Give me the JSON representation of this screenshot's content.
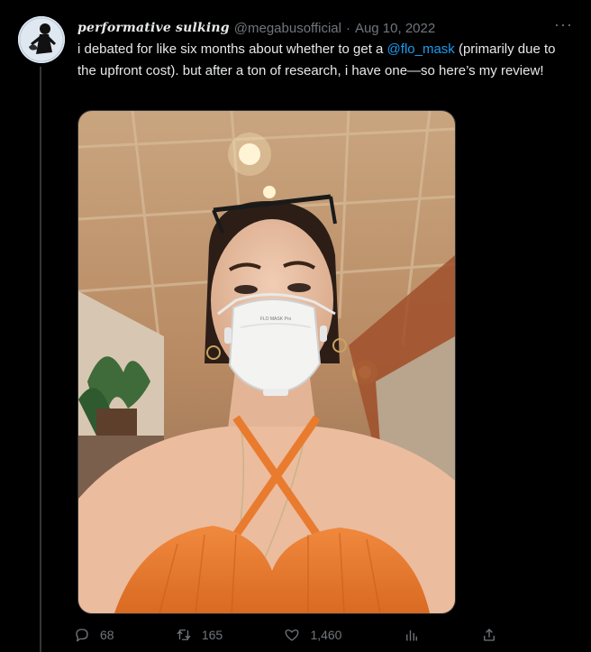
{
  "tweet": {
    "display_name": "performative sulking",
    "handle": "@megabusofficial",
    "separator": "·",
    "date": "Aug 10, 2022",
    "more_label": "···",
    "text_before": "i debated for like six months about whether to get a ",
    "mention": "@flo_mask",
    "text_after": " (primarily due to the upfront cost). but after a ton of research, i have one—so here’s my review!",
    "mask_label": "FLO MASK Pro"
  },
  "actions": {
    "reply_count": "68",
    "retweet_count": "165",
    "like_count": "1,460"
  },
  "icons": {
    "reply": "reply-icon",
    "retweet": "retweet-icon",
    "like": "heart-icon",
    "analytics": "analytics-icon",
    "share": "share-icon",
    "more": "more-icon"
  },
  "colors": {
    "background": "#000000",
    "text": "#e7e9ea",
    "muted": "#71767b",
    "link": "#1d9bf0"
  }
}
